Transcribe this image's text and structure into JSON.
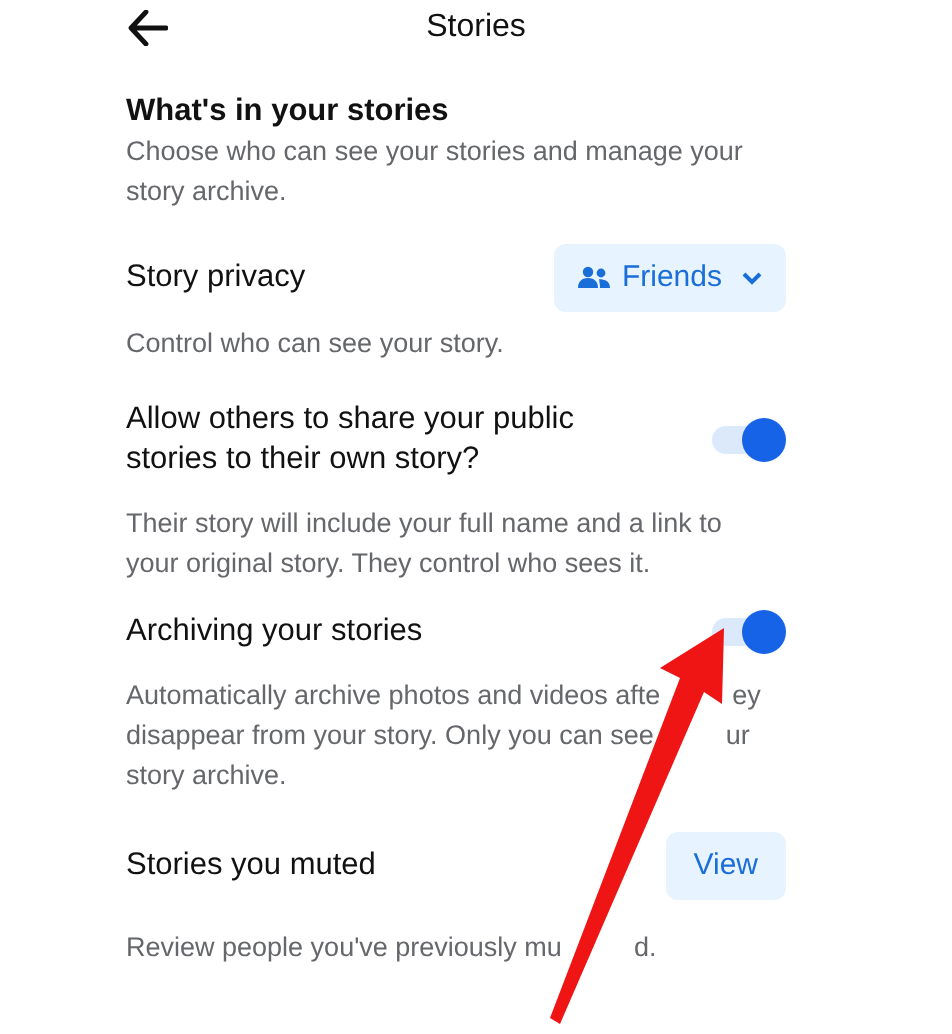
{
  "header": {
    "title": "Stories"
  },
  "intro": {
    "title": "What's in your stories",
    "description": [
      [
        "Choose who can see your stories and manage your"
      ],
      [
        "story archive."
      ]
    ]
  },
  "settings": [
    {
      "kind": "dropdown",
      "title": [
        "Story privacy"
      ],
      "button": "Friends",
      "description": [
        [
          "Control who can see your story."
        ]
      ]
    },
    {
      "kind": "toggle",
      "title": [
        "Allow others to share your public",
        "stories to their own story?"
      ],
      "on": true,
      "description": [
        [
          "Their story will include your full name and a link to"
        ],
        [
          "your original story. They control who sees it."
        ]
      ]
    },
    {
      "kind": "toggle",
      "title": [
        "Archiving your stories"
      ],
      "on": true,
      "description": [
        [
          "Automatically archive photos and videos afte",
          "ey"
        ],
        [
          "disappear from your story. Only you can see",
          "ur"
        ],
        [
          "story archive."
        ]
      ]
    },
    {
      "kind": "button",
      "title": [
        "Stories you muted"
      ],
      "button": "View",
      "description": [
        [
          "Review people you've previously mu",
          "d."
        ]
      ]
    }
  ]
}
